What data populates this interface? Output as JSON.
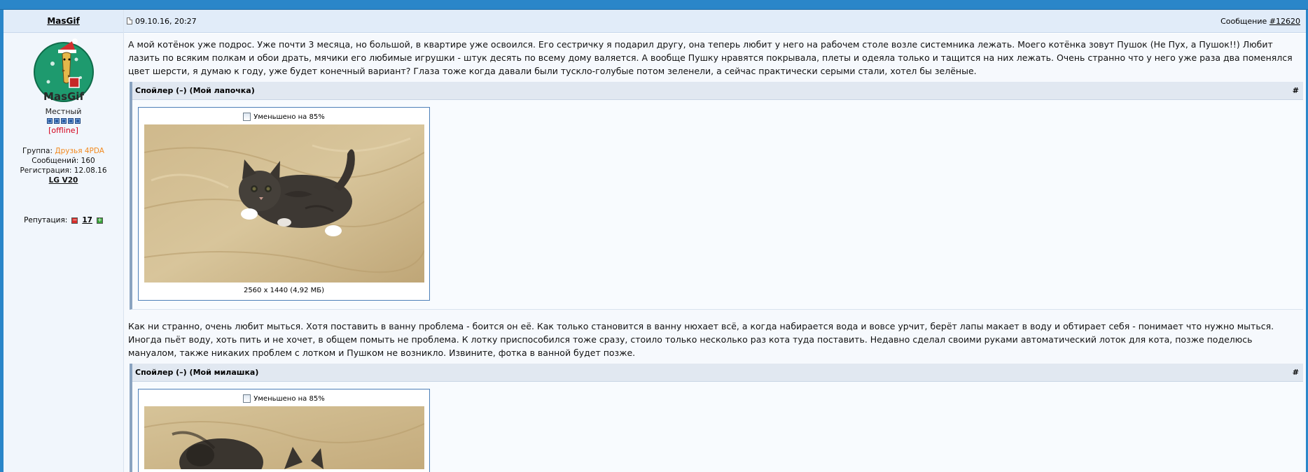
{
  "user": {
    "name": "MasGif",
    "avatar_text": "MasGif",
    "rank": "Местный",
    "status": "[offline]",
    "group_label": "Группа:",
    "group_value": "Друзья 4PDA",
    "posts_label": "Сообщений:",
    "posts_value": "160",
    "reg_label": "Регистрация:",
    "reg_value": "12.08.16",
    "device": "LG V20",
    "reputation_label": "Репутация:",
    "reputation_value": "17",
    "pip_color": "#2c5da3"
  },
  "post": {
    "date": "09.10.16, 20:27",
    "message_label": "Сообщение",
    "message_link": "#12620",
    "paragraph1": "А мой котёнок уже подрос. Уже почти 3 месяца, но большой, в квартире уже освоился. Его сестричку я подарил другу, она теперь любит у него на рабочем столе возле системника лежать. Моего котёнка зовут Пушок (Не Пух, а Пушок!!) Любит лазить по всяким полкам и обои драть, мячики его любимые игрушки - штук десять по всему дому валяется. А вообще Пушку нравятся покрывала, плеты и одеяла только и тащится на них лежать. Очень странно что у него уже раза два поменялся цвет шерсти, я думаю к году, уже будет конечный вариант? Глаза тоже когда давали были тускло-голубые потом зеленели, а сейчас практически серыми стали, хотел бы зелёные.",
    "paragraph2": "Как ни странно, очень любит мыться. Хотя поставить в ванну проблема - боится он её. Как только становится в ванну нюхает всё, а когда набирается вода и вовсе урчит, берёт лапы макает в воду и обтирает себя - понимает что нужно мыться. Иногда пьёт воду, хоть пить и не хочет, в общем помыть не проблема. К лотку приспособился тоже сразу, стоило только несколько раз кота туда поставить. Недавно сделал своими руками автоматический лоток для кота, позже поделюсь мануалом, также никаких проблем с лотком и Пушком не возникло. Извините, фотка в ванной будет позже.",
    "spoiler1_title": "Спойлер (–) (Мой лапочка)",
    "spoiler2_title": "Спойлер (–) (Мой милашка)",
    "spoiler_anchor": "#",
    "image_reduced": "Уменьшено на 85%",
    "image1_caption": "2560 x 1440 (4,92 МБ)"
  },
  "colors": {
    "topbar": "#2a86c9",
    "header_bg": "#e1ecf9",
    "group_orange": "#f28a1f",
    "offline_red": "#d4001a"
  }
}
